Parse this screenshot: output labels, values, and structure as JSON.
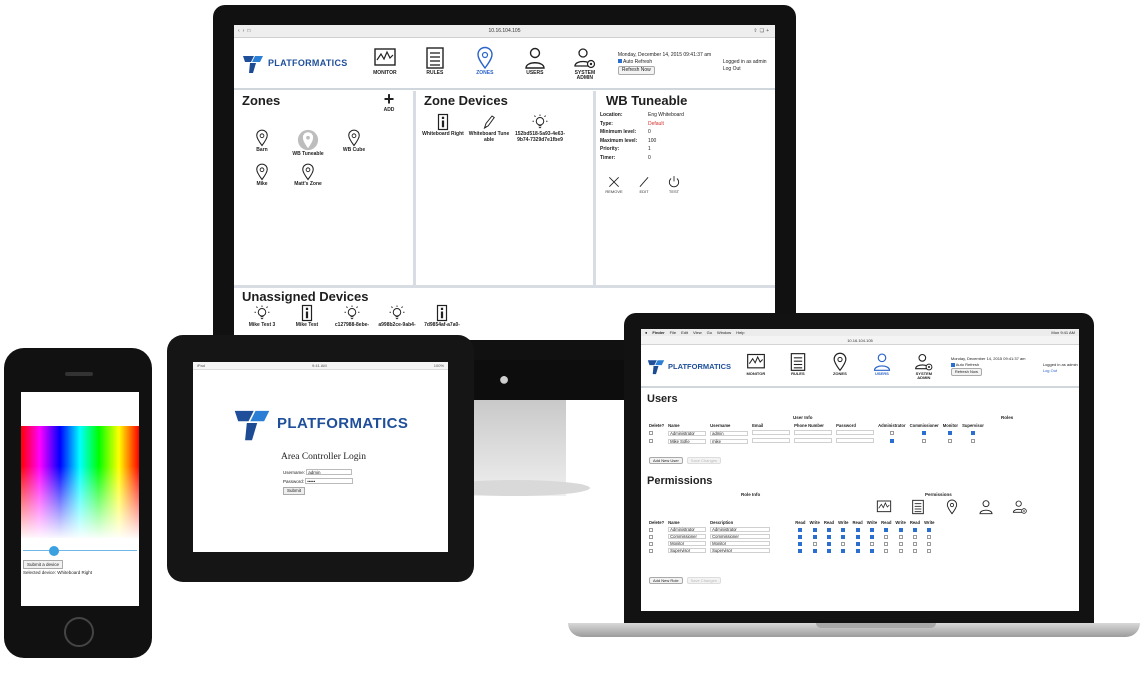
{
  "brand": {
    "name": "PLATFORMATICS",
    "color": "#1f4f9a",
    "accent": "#2a63c9",
    "logo_icon": "platformatics-logo"
  },
  "desktop": {
    "browser": {
      "url": "10.16.104.105"
    },
    "nav": [
      {
        "label": "MONITOR",
        "icon": "monitor-icon"
      },
      {
        "label": "RULES",
        "icon": "rules-icon"
      },
      {
        "label": "ZONES",
        "icon": "zones-icon",
        "active": true
      },
      {
        "label": "USERS",
        "icon": "users-icon"
      },
      {
        "label": "SYSTEM\nADMIN",
        "icon": "system-admin-icon"
      }
    ],
    "header_info": {
      "datetime": "Monday, December 14, 2015 09:41:37 am",
      "auto_refresh": "Auto Refresh",
      "refresh_button": "Refresh Now",
      "logged_in": "Logged in as admin",
      "logout": "Log Out"
    },
    "zones": {
      "title": "Zones",
      "add_label": "ADD",
      "items": [
        "Barn",
        "WB Tuneable",
        "WB Cube",
        "Mike",
        "Matt's Zone"
      ]
    },
    "zone_devices": {
      "title": "Zone Devices",
      "items": [
        "Whiteboard Right",
        "Whiteboard Tuneable",
        "152bd518-5a93-4e63-9b74-7329d7e1fbe9"
      ]
    },
    "wb_tuneable": {
      "title": "WB Tuneable",
      "fields": [
        {
          "key": "Location:",
          "value": "Eng Whiteboard"
        },
        {
          "key": "Type:",
          "value": "Default",
          "highlight": true
        },
        {
          "key": "Minimum level:",
          "value": "0"
        },
        {
          "key": "Maximum level:",
          "value": "100"
        },
        {
          "key": "Priority:",
          "value": "1"
        },
        {
          "key": "Timer:",
          "value": "0"
        }
      ],
      "actions": [
        "REMOVE",
        "EDIT",
        "TEST"
      ]
    },
    "unassigned": {
      "title": "Unassigned Devices",
      "items": [
        "Mike Test 3",
        "Mike Test",
        "c127988-8ebe-",
        "a998b2ce-9ab4-",
        "7d9854af-a7a0-"
      ]
    }
  },
  "phone": {
    "button": "Submit a device",
    "selected": "Selected device: Whiteboard Right"
  },
  "tablet": {
    "status_left": "iPad",
    "status_center": "9:41 AM",
    "status_right": "100%",
    "logo_text": "PLATFORMATICS",
    "login_title": "Area Controller Login",
    "username_label": "Username:",
    "username_value": "admin",
    "password_label": "Password:",
    "password_value": "•••••",
    "submit": "Submit"
  },
  "laptop": {
    "menubar": [
      "Finder",
      "File",
      "Edit",
      "View",
      "Go",
      "Window",
      "Help"
    ],
    "menubar_right": "Mon 9:41 AM",
    "url": "10.16.104.105",
    "nav": [
      {
        "label": "MONITOR",
        "icon": "monitor-icon"
      },
      {
        "label": "RULES",
        "icon": "rules-icon"
      },
      {
        "label": "ZONES",
        "icon": "zones-icon"
      },
      {
        "label": "USERS",
        "icon": "users-icon",
        "active": true
      },
      {
        "label": "SYSTEM\nADMIN",
        "icon": "system-admin-icon"
      }
    ],
    "header_info": {
      "datetime": "Monday, December 14, 2015 09:41:37 am",
      "auto_refresh": "Auto Refresh",
      "refresh_button": "Refresh Now",
      "logged_in": "Logged in as admin",
      "logout": "Log Out"
    },
    "users": {
      "title": "Users",
      "group_user_info": "User Info",
      "group_roles": "Roles",
      "columns": [
        "Delete?",
        "Name",
        "Username",
        "Email",
        "Phone Number",
        "Password",
        "Administrator",
        "Commissioner",
        "Monitor",
        "Supervisor"
      ],
      "rows": [
        {
          "name": "Administrator",
          "username": "admin",
          "email": "",
          "phone": "",
          "password": "",
          "roles": [
            false,
            true,
            true,
            true
          ]
        },
        {
          "name": "Mike Sofie",
          "username": "mike",
          "email": "",
          "phone": "",
          "password": "",
          "roles": [
            true,
            false,
            false,
            false
          ]
        }
      ],
      "add_button": "Add New User",
      "save_button": "Save Changes"
    },
    "permissions": {
      "title": "Permissions",
      "group_role_info": "Role Info",
      "group_permissions": "Permissions",
      "columns": [
        "Delete?",
        "Name",
        "Description"
      ],
      "perm_columns": [
        "Read",
        "Write",
        "Read",
        "Write",
        "Read",
        "Write",
        "Read",
        "Write",
        "Read",
        "Write"
      ],
      "perm_icons": [
        "monitor-icon",
        "rules-icon",
        "zones-icon",
        "users-icon",
        "system-admin-icon"
      ],
      "rows": [
        {
          "name": "Administrator",
          "description": "Administrator",
          "perms": [
            true,
            true,
            true,
            true,
            true,
            true,
            true,
            true,
            true,
            true
          ]
        },
        {
          "name": "Commissioner",
          "description": "Commissioner",
          "perms": [
            true,
            true,
            true,
            true,
            true,
            true,
            false,
            false,
            false,
            false
          ]
        },
        {
          "name": "Monitor",
          "description": "Monitor",
          "perms": [
            true,
            false,
            true,
            false,
            true,
            false,
            false,
            false,
            false,
            false
          ]
        },
        {
          "name": "Supervisor",
          "description": "Supervisor",
          "perms": [
            true,
            true,
            true,
            true,
            true,
            true,
            false,
            false,
            false,
            false
          ]
        }
      ],
      "add_button": "Add New Role",
      "save_button": "Save Changes"
    }
  }
}
